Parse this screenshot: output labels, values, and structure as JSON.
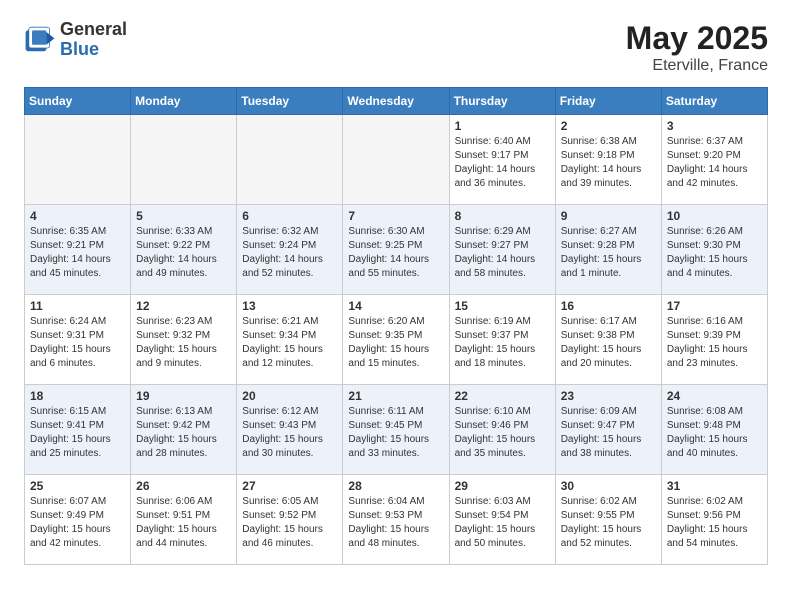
{
  "header": {
    "logo_general": "General",
    "logo_blue": "Blue",
    "month": "May 2025",
    "location": "Eterville, France"
  },
  "weekdays": [
    "Sunday",
    "Monday",
    "Tuesday",
    "Wednesday",
    "Thursday",
    "Friday",
    "Saturday"
  ],
  "weeks": [
    [
      {
        "day": "",
        "info": ""
      },
      {
        "day": "",
        "info": ""
      },
      {
        "day": "",
        "info": ""
      },
      {
        "day": "",
        "info": ""
      },
      {
        "day": "1",
        "info": "Sunrise: 6:40 AM\nSunset: 9:17 PM\nDaylight: 14 hours\nand 36 minutes."
      },
      {
        "day": "2",
        "info": "Sunrise: 6:38 AM\nSunset: 9:18 PM\nDaylight: 14 hours\nand 39 minutes."
      },
      {
        "day": "3",
        "info": "Sunrise: 6:37 AM\nSunset: 9:20 PM\nDaylight: 14 hours\nand 42 minutes."
      }
    ],
    [
      {
        "day": "4",
        "info": "Sunrise: 6:35 AM\nSunset: 9:21 PM\nDaylight: 14 hours\nand 45 minutes."
      },
      {
        "day": "5",
        "info": "Sunrise: 6:33 AM\nSunset: 9:22 PM\nDaylight: 14 hours\nand 49 minutes."
      },
      {
        "day": "6",
        "info": "Sunrise: 6:32 AM\nSunset: 9:24 PM\nDaylight: 14 hours\nand 52 minutes."
      },
      {
        "day": "7",
        "info": "Sunrise: 6:30 AM\nSunset: 9:25 PM\nDaylight: 14 hours\nand 55 minutes."
      },
      {
        "day": "8",
        "info": "Sunrise: 6:29 AM\nSunset: 9:27 PM\nDaylight: 14 hours\nand 58 minutes."
      },
      {
        "day": "9",
        "info": "Sunrise: 6:27 AM\nSunset: 9:28 PM\nDaylight: 15 hours\nand 1 minute."
      },
      {
        "day": "10",
        "info": "Sunrise: 6:26 AM\nSunset: 9:30 PM\nDaylight: 15 hours\nand 4 minutes."
      }
    ],
    [
      {
        "day": "11",
        "info": "Sunrise: 6:24 AM\nSunset: 9:31 PM\nDaylight: 15 hours\nand 6 minutes."
      },
      {
        "day": "12",
        "info": "Sunrise: 6:23 AM\nSunset: 9:32 PM\nDaylight: 15 hours\nand 9 minutes."
      },
      {
        "day": "13",
        "info": "Sunrise: 6:21 AM\nSunset: 9:34 PM\nDaylight: 15 hours\nand 12 minutes."
      },
      {
        "day": "14",
        "info": "Sunrise: 6:20 AM\nSunset: 9:35 PM\nDaylight: 15 hours\nand 15 minutes."
      },
      {
        "day": "15",
        "info": "Sunrise: 6:19 AM\nSunset: 9:37 PM\nDaylight: 15 hours\nand 18 minutes."
      },
      {
        "day": "16",
        "info": "Sunrise: 6:17 AM\nSunset: 9:38 PM\nDaylight: 15 hours\nand 20 minutes."
      },
      {
        "day": "17",
        "info": "Sunrise: 6:16 AM\nSunset: 9:39 PM\nDaylight: 15 hours\nand 23 minutes."
      }
    ],
    [
      {
        "day": "18",
        "info": "Sunrise: 6:15 AM\nSunset: 9:41 PM\nDaylight: 15 hours\nand 25 minutes."
      },
      {
        "day": "19",
        "info": "Sunrise: 6:13 AM\nSunset: 9:42 PM\nDaylight: 15 hours\nand 28 minutes."
      },
      {
        "day": "20",
        "info": "Sunrise: 6:12 AM\nSunset: 9:43 PM\nDaylight: 15 hours\nand 30 minutes."
      },
      {
        "day": "21",
        "info": "Sunrise: 6:11 AM\nSunset: 9:45 PM\nDaylight: 15 hours\nand 33 minutes."
      },
      {
        "day": "22",
        "info": "Sunrise: 6:10 AM\nSunset: 9:46 PM\nDaylight: 15 hours\nand 35 minutes."
      },
      {
        "day": "23",
        "info": "Sunrise: 6:09 AM\nSunset: 9:47 PM\nDaylight: 15 hours\nand 38 minutes."
      },
      {
        "day": "24",
        "info": "Sunrise: 6:08 AM\nSunset: 9:48 PM\nDaylight: 15 hours\nand 40 minutes."
      }
    ],
    [
      {
        "day": "25",
        "info": "Sunrise: 6:07 AM\nSunset: 9:49 PM\nDaylight: 15 hours\nand 42 minutes."
      },
      {
        "day": "26",
        "info": "Sunrise: 6:06 AM\nSunset: 9:51 PM\nDaylight: 15 hours\nand 44 minutes."
      },
      {
        "day": "27",
        "info": "Sunrise: 6:05 AM\nSunset: 9:52 PM\nDaylight: 15 hours\nand 46 minutes."
      },
      {
        "day": "28",
        "info": "Sunrise: 6:04 AM\nSunset: 9:53 PM\nDaylight: 15 hours\nand 48 minutes."
      },
      {
        "day": "29",
        "info": "Sunrise: 6:03 AM\nSunset: 9:54 PM\nDaylight: 15 hours\nand 50 minutes."
      },
      {
        "day": "30",
        "info": "Sunrise: 6:02 AM\nSunset: 9:55 PM\nDaylight: 15 hours\nand 52 minutes."
      },
      {
        "day": "31",
        "info": "Sunrise: 6:02 AM\nSunset: 9:56 PM\nDaylight: 15 hours\nand 54 minutes."
      }
    ]
  ]
}
